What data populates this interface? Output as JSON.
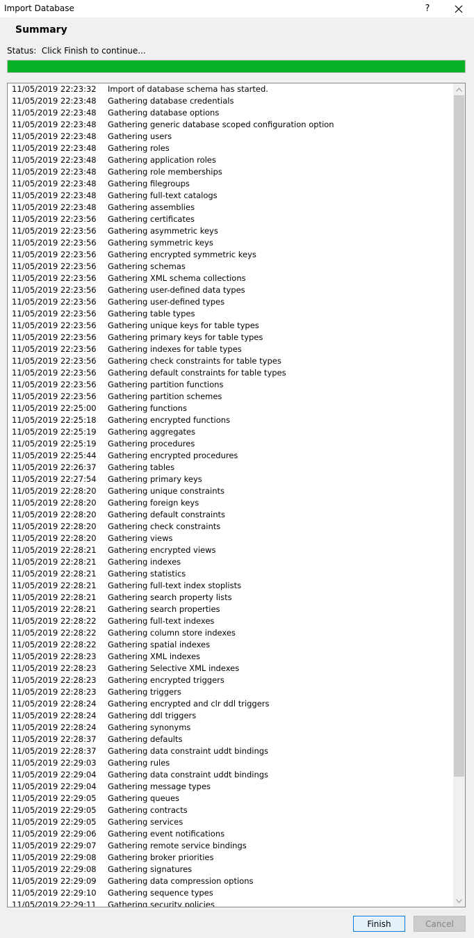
{
  "window": {
    "title": "Import Database",
    "help_label": "?"
  },
  "heading": "Summary",
  "status": {
    "label": "Status:",
    "text": "Click Finish to continue..."
  },
  "progress": {
    "percent": 100,
    "color": "#06b025"
  },
  "log": [
    {
      "ts": "11/05/2019 22:23:32",
      "msg": "Import of database schema has started."
    },
    {
      "ts": "11/05/2019 22:23:48",
      "msg": "Gathering database credentials"
    },
    {
      "ts": "11/05/2019 22:23:48",
      "msg": "Gathering database options"
    },
    {
      "ts": "11/05/2019 22:23:48",
      "msg": "Gathering generic database scoped configuration option"
    },
    {
      "ts": "11/05/2019 22:23:48",
      "msg": "Gathering users"
    },
    {
      "ts": "11/05/2019 22:23:48",
      "msg": "Gathering roles"
    },
    {
      "ts": "11/05/2019 22:23:48",
      "msg": "Gathering application roles"
    },
    {
      "ts": "11/05/2019 22:23:48",
      "msg": "Gathering role memberships"
    },
    {
      "ts": "11/05/2019 22:23:48",
      "msg": "Gathering filegroups"
    },
    {
      "ts": "11/05/2019 22:23:48",
      "msg": "Gathering full-text catalogs"
    },
    {
      "ts": "11/05/2019 22:23:48",
      "msg": "Gathering assemblies"
    },
    {
      "ts": "11/05/2019 22:23:56",
      "msg": "Gathering certificates"
    },
    {
      "ts": "11/05/2019 22:23:56",
      "msg": "Gathering asymmetric keys"
    },
    {
      "ts": "11/05/2019 22:23:56",
      "msg": "Gathering symmetric keys"
    },
    {
      "ts": "11/05/2019 22:23:56",
      "msg": "Gathering encrypted symmetric keys"
    },
    {
      "ts": "11/05/2019 22:23:56",
      "msg": "Gathering schemas"
    },
    {
      "ts": "11/05/2019 22:23:56",
      "msg": "Gathering XML schema collections"
    },
    {
      "ts": "11/05/2019 22:23:56",
      "msg": "Gathering user-defined data types"
    },
    {
      "ts": "11/05/2019 22:23:56",
      "msg": "Gathering user-defined types"
    },
    {
      "ts": "11/05/2019 22:23:56",
      "msg": "Gathering table types"
    },
    {
      "ts": "11/05/2019 22:23:56",
      "msg": "Gathering unique keys for table types"
    },
    {
      "ts": "11/05/2019 22:23:56",
      "msg": "Gathering primary keys for table types"
    },
    {
      "ts": "11/05/2019 22:23:56",
      "msg": "Gathering indexes for table types"
    },
    {
      "ts": "11/05/2019 22:23:56",
      "msg": "Gathering check constraints for table types"
    },
    {
      "ts": "11/05/2019 22:23:56",
      "msg": "Gathering default constraints for table types"
    },
    {
      "ts": "11/05/2019 22:23:56",
      "msg": "Gathering partition functions"
    },
    {
      "ts": "11/05/2019 22:23:56",
      "msg": "Gathering partition schemes"
    },
    {
      "ts": "11/05/2019 22:25:00",
      "msg": "Gathering functions"
    },
    {
      "ts": "11/05/2019 22:25:18",
      "msg": "Gathering encrypted functions"
    },
    {
      "ts": "11/05/2019 22:25:19",
      "msg": "Gathering aggregates"
    },
    {
      "ts": "11/05/2019 22:25:19",
      "msg": "Gathering procedures"
    },
    {
      "ts": "11/05/2019 22:25:44",
      "msg": "Gathering encrypted procedures"
    },
    {
      "ts": "11/05/2019 22:26:37",
      "msg": "Gathering tables"
    },
    {
      "ts": "11/05/2019 22:27:54",
      "msg": "Gathering primary keys"
    },
    {
      "ts": "11/05/2019 22:28:20",
      "msg": "Gathering unique constraints"
    },
    {
      "ts": "11/05/2019 22:28:20",
      "msg": "Gathering foreign keys"
    },
    {
      "ts": "11/05/2019 22:28:20",
      "msg": "Gathering default constraints"
    },
    {
      "ts": "11/05/2019 22:28:20",
      "msg": "Gathering check constraints"
    },
    {
      "ts": "11/05/2019 22:28:20",
      "msg": "Gathering views"
    },
    {
      "ts": "11/05/2019 22:28:21",
      "msg": "Gathering encrypted views"
    },
    {
      "ts": "11/05/2019 22:28:21",
      "msg": "Gathering indexes"
    },
    {
      "ts": "11/05/2019 22:28:21",
      "msg": "Gathering statistics"
    },
    {
      "ts": "11/05/2019 22:28:21",
      "msg": "Gathering full-text index stoplists"
    },
    {
      "ts": "11/05/2019 22:28:21",
      "msg": "Gathering search property lists"
    },
    {
      "ts": "11/05/2019 22:28:21",
      "msg": "Gathering search properties"
    },
    {
      "ts": "11/05/2019 22:28:22",
      "msg": "Gathering full-text indexes"
    },
    {
      "ts": "11/05/2019 22:28:22",
      "msg": "Gathering column store indexes"
    },
    {
      "ts": "11/05/2019 22:28:22",
      "msg": "Gathering spatial indexes"
    },
    {
      "ts": "11/05/2019 22:28:23",
      "msg": "Gathering XML indexes"
    },
    {
      "ts": "11/05/2019 22:28:23",
      "msg": "Gathering Selective XML indexes"
    },
    {
      "ts": "11/05/2019 22:28:23",
      "msg": "Gathering encrypted triggers"
    },
    {
      "ts": "11/05/2019 22:28:23",
      "msg": "Gathering triggers"
    },
    {
      "ts": "11/05/2019 22:28:24",
      "msg": "Gathering encrypted and clr ddl triggers"
    },
    {
      "ts": "11/05/2019 22:28:24",
      "msg": "Gathering ddl triggers"
    },
    {
      "ts": "11/05/2019 22:28:24",
      "msg": "Gathering synonyms"
    },
    {
      "ts": "11/05/2019 22:28:37",
      "msg": "Gathering defaults"
    },
    {
      "ts": "11/05/2019 22:28:37",
      "msg": "Gathering data constraint uddt bindings"
    },
    {
      "ts": "11/05/2019 22:29:03",
      "msg": "Gathering rules"
    },
    {
      "ts": "11/05/2019 22:29:04",
      "msg": "Gathering data constraint uddt bindings"
    },
    {
      "ts": "11/05/2019 22:29:04",
      "msg": "Gathering message types"
    },
    {
      "ts": "11/05/2019 22:29:05",
      "msg": "Gathering queues"
    },
    {
      "ts": "11/05/2019 22:29:05",
      "msg": "Gathering contracts"
    },
    {
      "ts": "11/05/2019 22:29:05",
      "msg": "Gathering services"
    },
    {
      "ts": "11/05/2019 22:29:06",
      "msg": "Gathering event notifications"
    },
    {
      "ts": "11/05/2019 22:29:07",
      "msg": "Gathering remote service bindings"
    },
    {
      "ts": "11/05/2019 22:29:08",
      "msg": "Gathering broker priorities"
    },
    {
      "ts": "11/05/2019 22:29:08",
      "msg": "Gathering signatures"
    },
    {
      "ts": "11/05/2019 22:29:09",
      "msg": "Gathering data compression options"
    },
    {
      "ts": "11/05/2019 22:29:10",
      "msg": "Gathering sequence types"
    },
    {
      "ts": "11/05/2019 22:29:11",
      "msg": "Gathering security policies"
    }
  ],
  "buttons": {
    "finish": "Finish",
    "cancel": "Cancel"
  },
  "icons": {
    "close": "close-icon",
    "scroll_up": "chevron-up-icon",
    "scroll_down": "chevron-down-icon"
  }
}
